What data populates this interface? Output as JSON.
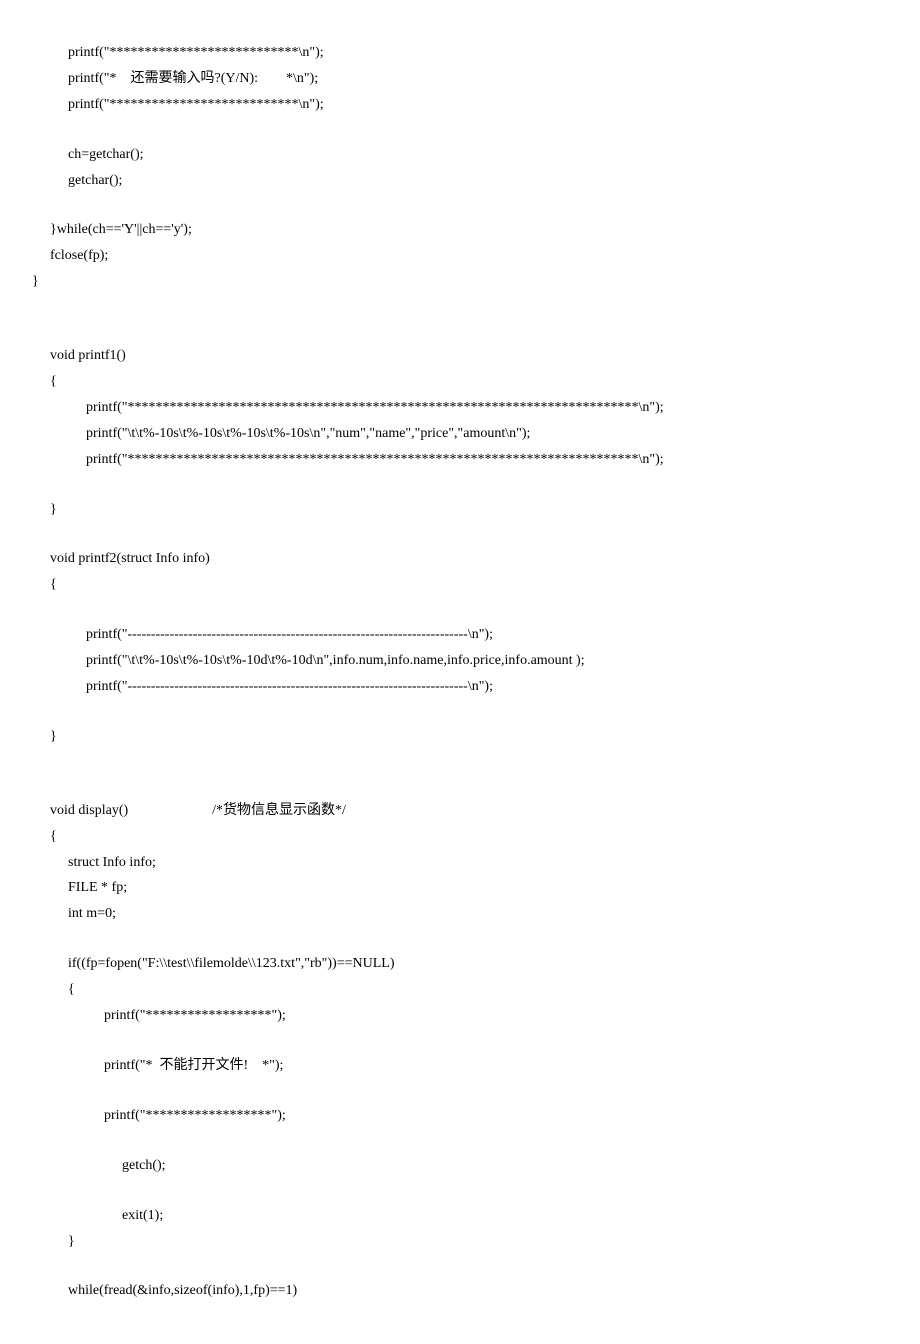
{
  "lines": [
    {
      "indent": 1,
      "text": "printf(\"***************************\\n\");"
    },
    {
      "indent": 1,
      "text": "printf(\"*    还需要输入吗?(Y/N):        *\\n\");"
    },
    {
      "indent": 1,
      "text": "printf(\"***************************\\n\");"
    },
    {
      "indent": 0,
      "text": "",
      "blank": true
    },
    {
      "indent": 1,
      "text": "ch=getchar();"
    },
    {
      "indent": 1,
      "text": "getchar();"
    },
    {
      "indent": 0,
      "text": "",
      "blank": true
    },
    {
      "indent": 0,
      "text": "}while(ch=='Y'||ch=='y');"
    },
    {
      "indent": 0,
      "text": "fclose(fp);"
    },
    {
      "indent": 0,
      "text": "}",
      "outdent": true
    },
    {
      "indent": 0,
      "text": "",
      "blank": true
    },
    {
      "indent": 0,
      "text": "",
      "blank": true
    },
    {
      "indent": 0,
      "text": "void printf1()"
    },
    {
      "indent": 0,
      "text": "{"
    },
    {
      "indent": 2,
      "text": "printf(\"*************************************************************************\\n\");"
    },
    {
      "indent": 2,
      "text": "printf(\"\\t\\t%-10s\\t%-10s\\t%-10s\\t%-10s\\n\",\"num\",\"name\",\"price\",\"amount\\n\");"
    },
    {
      "indent": 2,
      "text": "printf(\"*************************************************************************\\n\");"
    },
    {
      "indent": 0,
      "text": "",
      "blank": true
    },
    {
      "indent": 0,
      "text": "}"
    },
    {
      "indent": 0,
      "text": "",
      "blank": true
    },
    {
      "indent": 0,
      "text": "void printf2(struct Info info)"
    },
    {
      "indent": 0,
      "text": "{"
    },
    {
      "indent": 0,
      "text": "",
      "blank": true
    },
    {
      "indent": 2,
      "text": "printf(\"-------------------------------------------------------------------------\\n\");"
    },
    {
      "indent": 2,
      "text": "printf(\"\\t\\t%-10s\\t%-10s\\t%-10d\\t%-10d\\n\",info.num,info.name,info.price,info.amount );"
    },
    {
      "indent": 2,
      "text": "printf(\"-------------------------------------------------------------------------\\n\");"
    },
    {
      "indent": 0,
      "text": "",
      "blank": true
    },
    {
      "indent": 0,
      "text": "}"
    },
    {
      "indent": 0,
      "text": "",
      "blank": true
    },
    {
      "indent": 0,
      "text": "",
      "blank": true
    },
    {
      "indent": 0,
      "text": "void display()                        /*货物信息显示函数*/"
    },
    {
      "indent": 0,
      "text": "{"
    },
    {
      "indent": 1,
      "text": "struct Info info;"
    },
    {
      "indent": 1,
      "text": "FILE * fp;"
    },
    {
      "indent": 1,
      "text": "int m=0;"
    },
    {
      "indent": 0,
      "text": "",
      "blank": true
    },
    {
      "indent": 1,
      "text": "if((fp=fopen(\"F:\\\\test\\\\filemolde\\\\123.txt\",\"rb\"))==NULL)"
    },
    {
      "indent": 1,
      "text": "{"
    },
    {
      "indent": 3,
      "text": "printf(\"******************\");"
    },
    {
      "indent": 0,
      "text": "",
      "blank": true
    },
    {
      "indent": 3,
      "text": "printf(\"*  不能打开文件!    *\");"
    },
    {
      "indent": 0,
      "text": "",
      "blank": true
    },
    {
      "indent": 3,
      "text": "printf(\"******************\");"
    },
    {
      "indent": 0,
      "text": "",
      "blank": true
    },
    {
      "indent": 4,
      "text": "getch();"
    },
    {
      "indent": 0,
      "text": "",
      "blank": true
    },
    {
      "indent": 4,
      "text": "exit(1);"
    },
    {
      "indent": 1,
      "text": "}"
    },
    {
      "indent": 0,
      "text": "",
      "blank": true
    },
    {
      "indent": 1,
      "text": "while(fread(&info,sizeof(info),1,fp)==1)"
    }
  ]
}
